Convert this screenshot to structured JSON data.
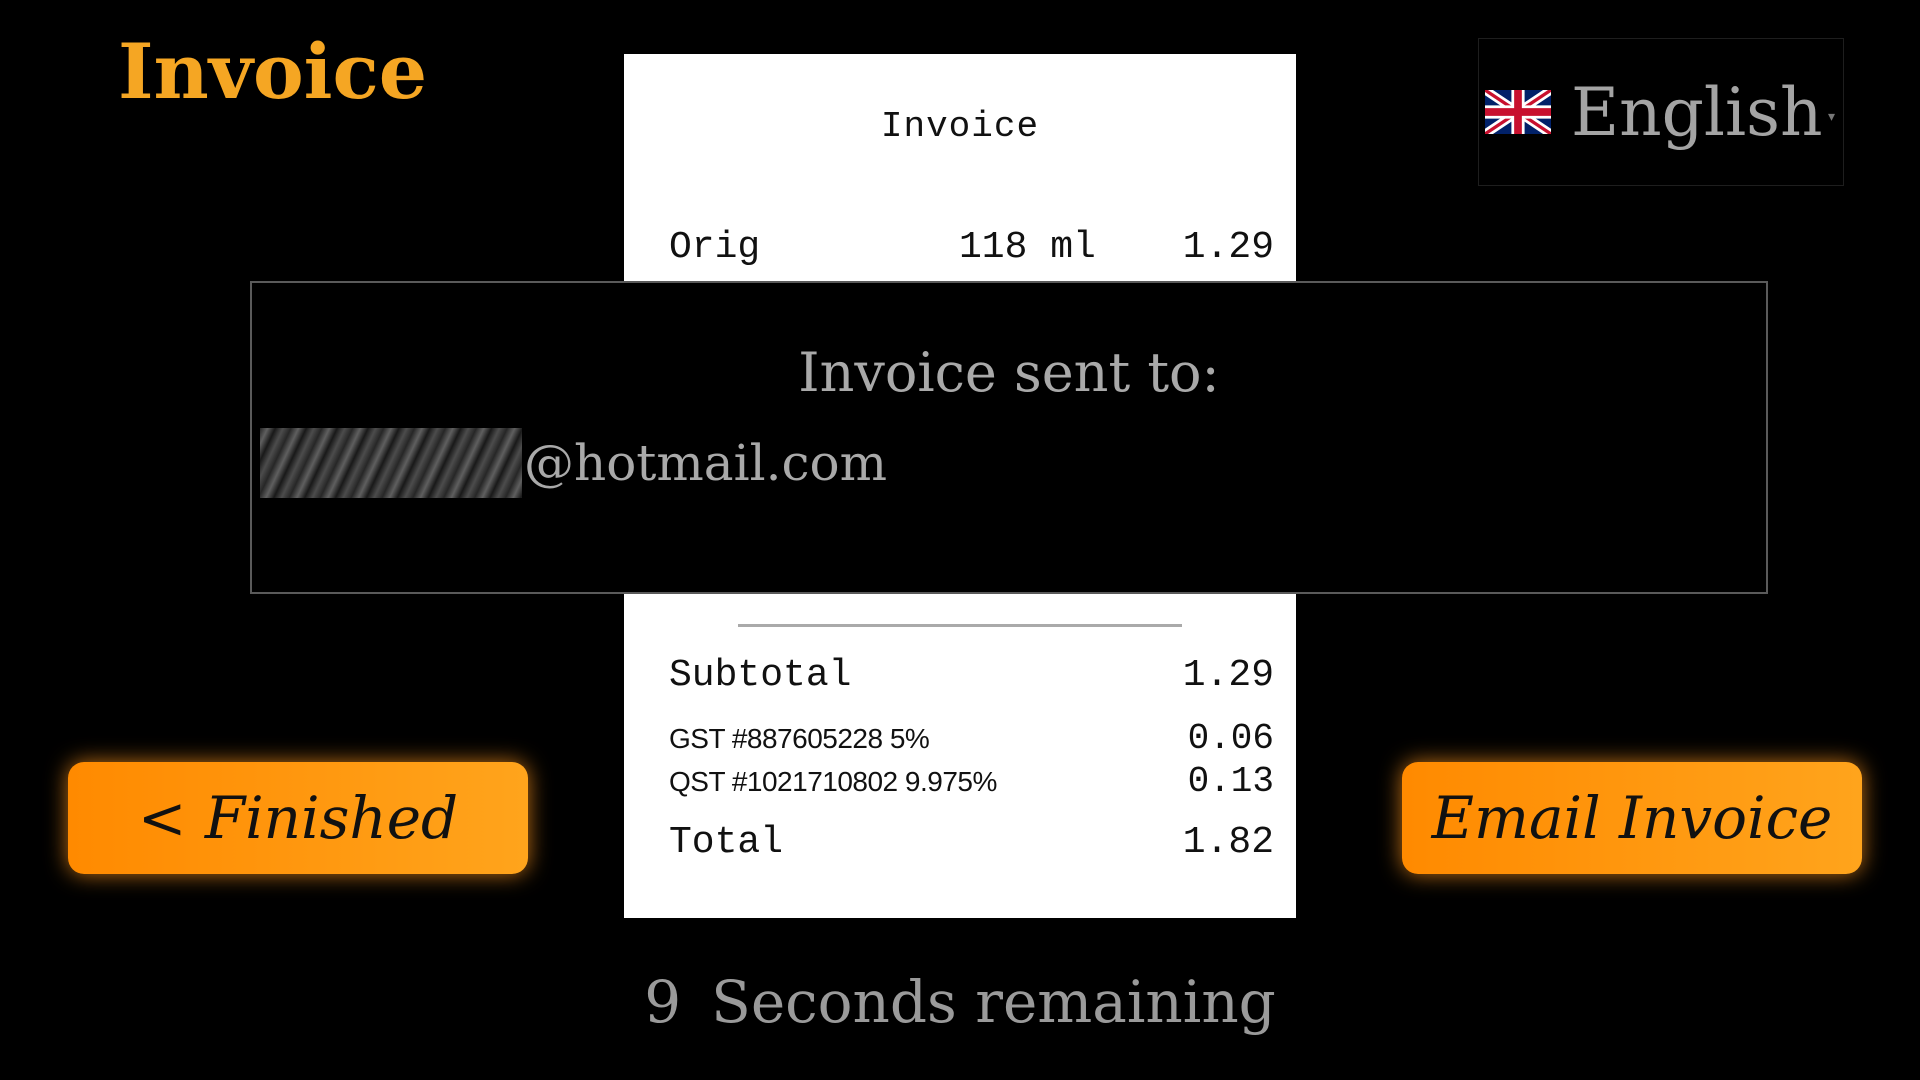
{
  "header": {
    "title": "Invoice"
  },
  "language": {
    "selected": "English",
    "flag_icon": "uk-flag-icon"
  },
  "receipt": {
    "title": "Invoice",
    "item": {
      "name": "Orig",
      "qty": "118 ml",
      "price": "1.29"
    },
    "subtotal": {
      "label": "Subtotal",
      "value": "1.29"
    },
    "gst": {
      "label": "GST #887605228 5%",
      "value": "0.06"
    },
    "qst": {
      "label": "QST #1021710802 9.975%",
      "value": "0.13"
    },
    "total": {
      "label": "Total",
      "value": "1.82"
    }
  },
  "modal": {
    "heading": "Invoice sent to:",
    "email_domain": "@hotmail.com"
  },
  "buttons": {
    "finished": "< Finished",
    "email_invoice": "Email Invoice"
  },
  "countdown": {
    "seconds": "9",
    "label": "Seconds remaining"
  },
  "colors": {
    "accent": "#f5a623",
    "button_start": "#ff8a00",
    "button_end": "#ffa41c",
    "text_muted": "#a9a9a9"
  }
}
